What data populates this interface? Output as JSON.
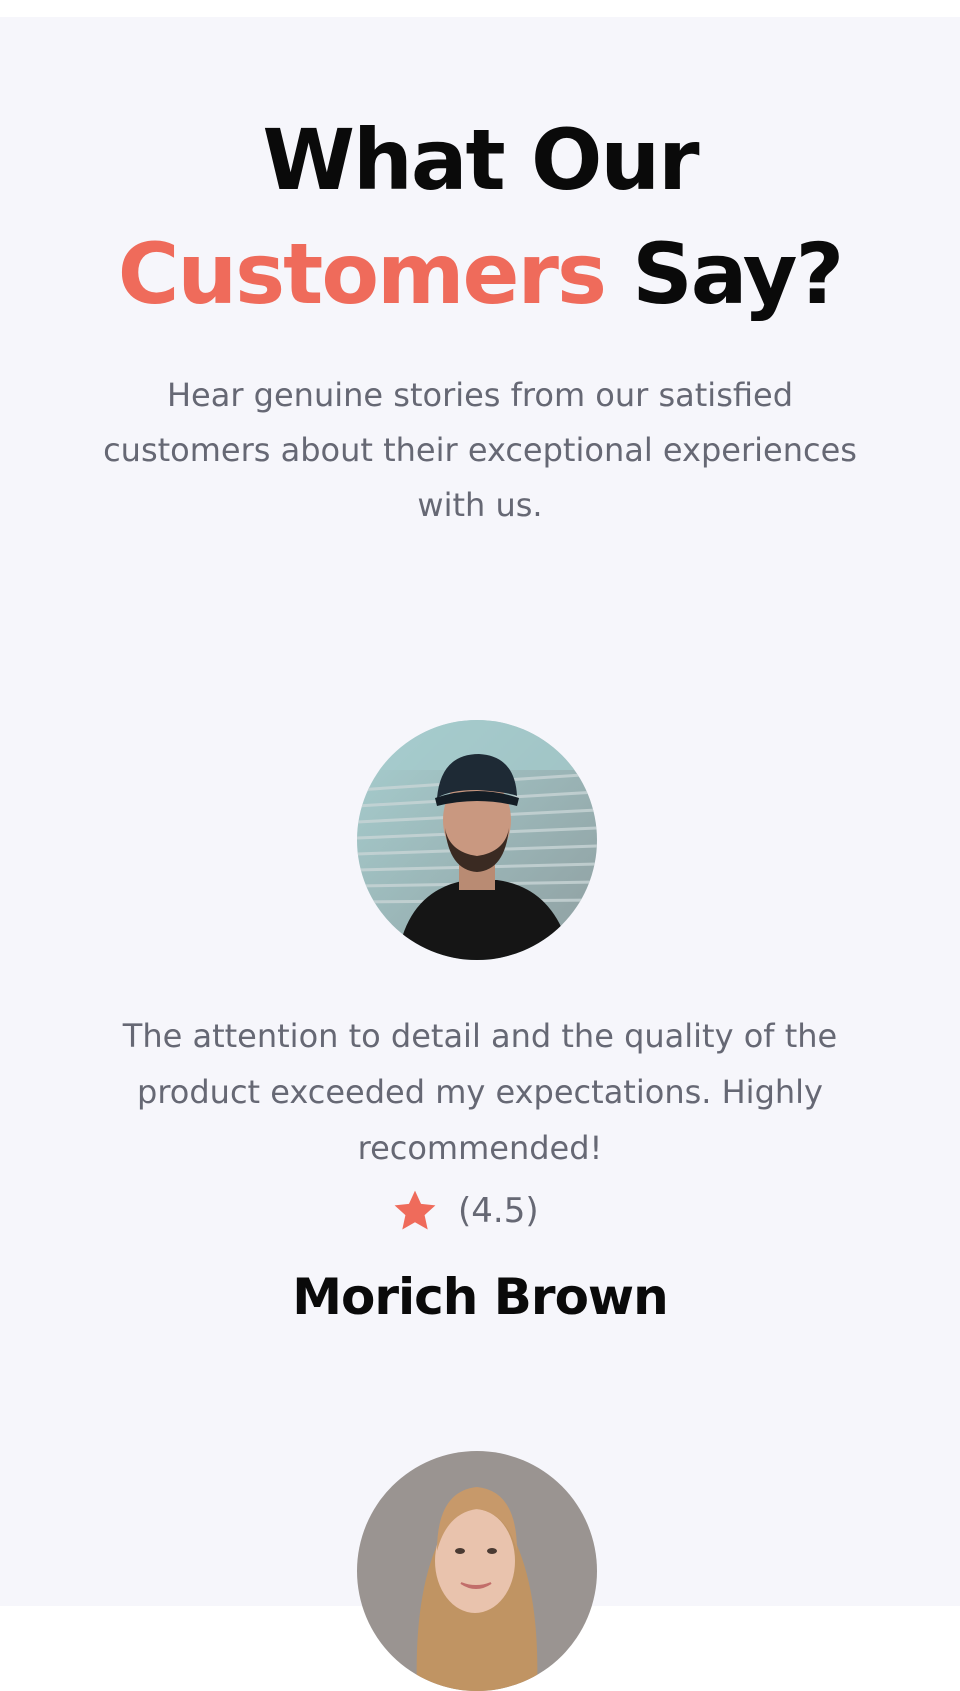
{
  "section": {
    "title_line1": "What Our",
    "title_accent": "Customers",
    "title_rest": " Say?",
    "subtitle": "Hear genuine stories from our satisfied customers about their exceptional experiences with us.",
    "accent_color": "#ef6b5b"
  },
  "testimonials": [
    {
      "avatar_icon": "avatar-man-cap",
      "quote": "The attention to detail and the quality of the product exceeded my expectations. Highly recommended!",
      "rating_icon": "star-icon",
      "rating": "(4.5)",
      "name": "Morich Brown"
    },
    {
      "avatar_icon": "avatar-woman"
    }
  ]
}
